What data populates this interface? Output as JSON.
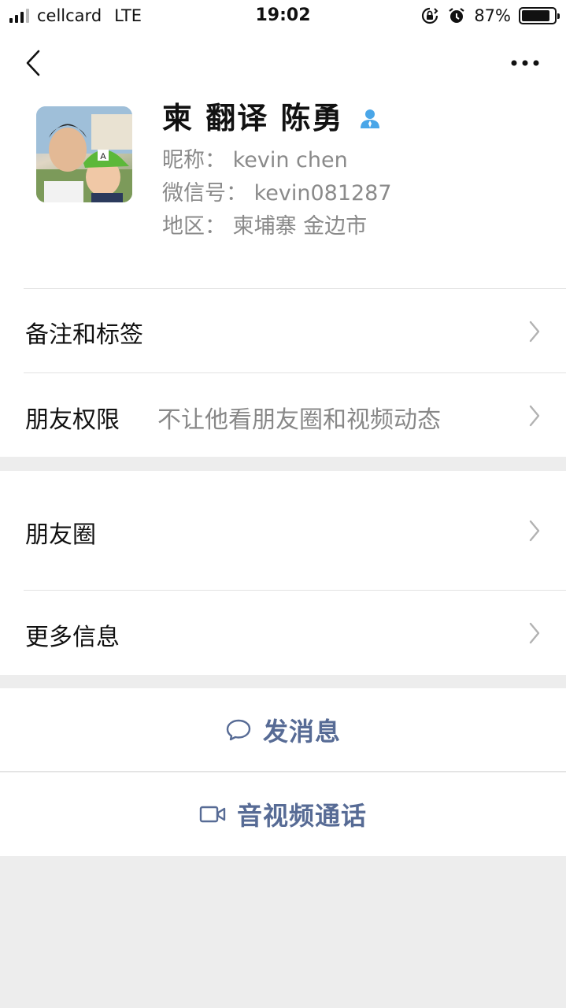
{
  "status_bar": {
    "carrier": "cellcard",
    "network": "LTE",
    "time": "19:02",
    "battery": "87%",
    "battery_level": 0.87,
    "icons": [
      "signal-icon",
      "orientation-lock-icon",
      "alarm-icon",
      "battery-icon"
    ]
  },
  "nav": {
    "back_icon": "chevron-left-icon",
    "more_icon": "ellipsis-icon"
  },
  "profile": {
    "display_name": "柬 翻译 陈勇",
    "badge_icon": "person-icon",
    "nickname": "昵称：  kevin chen",
    "wechat_id": "微信号：  kevin081287",
    "region": "地区：  柬埔寨 金边市"
  },
  "menu": {
    "remark_tags": "备注和标签",
    "friend_permission": "朋友权限",
    "friend_permission_value": "不让他看朋友圈和视频动态",
    "moments": "朋友圈",
    "more_info": "更多信息"
  },
  "actions": {
    "send_message": "发消息",
    "video_call": "音视频通话"
  },
  "colors": {
    "page_background": "#ededed",
    "link_blue": "#576b95",
    "badge_blue": "#4aa6e8",
    "secondary_text": "#888888"
  }
}
